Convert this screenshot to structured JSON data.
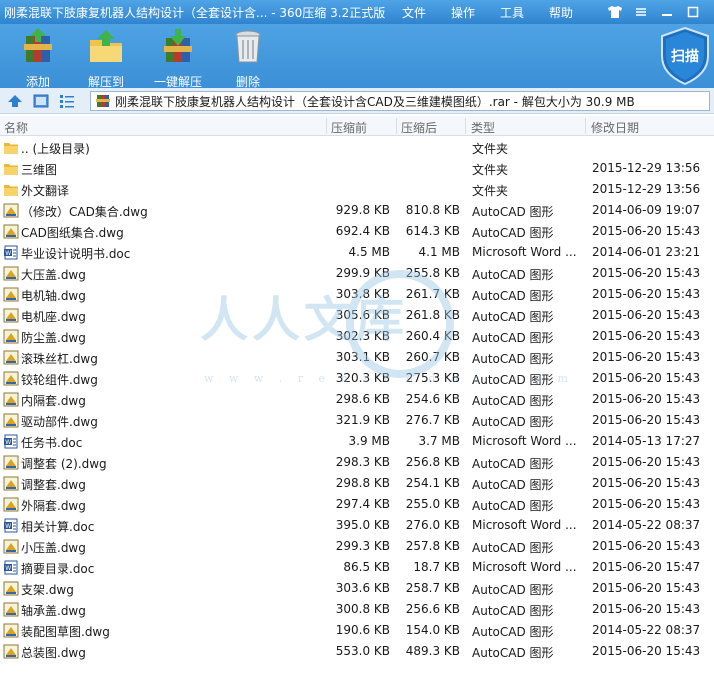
{
  "window": {
    "title": "刚柔混联下肢康复机器人结构设计（全套设计含... - 360压缩 3.2正式版",
    "menus": [
      "文件",
      "操作",
      "工具",
      "帮助"
    ]
  },
  "toolbar": {
    "add_label": "添加",
    "extract_label": "解压到",
    "oneclick_label": "一键解压",
    "delete_label": "删除",
    "scan_label": "扫描"
  },
  "address": {
    "path": "刚柔混联下肢康复机器人结构设计（全套设计含CAD及三维建模图纸）.rar - 解包大小为 30.9 MB"
  },
  "columns": {
    "name": "名称",
    "compressed": "压缩前",
    "original": "压缩后",
    "type": "类型",
    "modified": "修改日期"
  },
  "watermark": {
    "text": "人人文库",
    "url": "w w w . r e n r e n d o c . c o m"
  },
  "files": [
    {
      "icon": "folder-up-icon",
      "name": ".. (上级目录)",
      "comp": "",
      "orig": "",
      "type": "文件夹",
      "date": ""
    },
    {
      "icon": "folder-icon",
      "name": "三维图",
      "comp": "",
      "orig": "",
      "type": "文件夹",
      "date": "2015-12-29 13:56"
    },
    {
      "icon": "folder-icon",
      "name": "外文翻译",
      "comp": "",
      "orig": "",
      "type": "文件夹",
      "date": "2015-12-29 13:56"
    },
    {
      "icon": "dwg-icon",
      "name": "（修改）CAD集合.dwg",
      "comp": "929.8 KB",
      "orig": "810.8 KB",
      "type": "AutoCAD 图形",
      "date": "2014-06-09 19:07"
    },
    {
      "icon": "dwg-icon",
      "name": "CAD图纸集合.dwg",
      "comp": "692.4 KB",
      "orig": "614.3 KB",
      "type": "AutoCAD 图形",
      "date": "2015-06-20 15:43"
    },
    {
      "icon": "doc-icon",
      "name": "毕业设计说明书.doc",
      "comp": "4.5 MB",
      "orig": "4.1 MB",
      "type": "Microsoft Word ...",
      "date": "2014-06-01 23:21"
    },
    {
      "icon": "dwg-icon",
      "name": "大压盖.dwg",
      "comp": "299.9 KB",
      "orig": "255.8 KB",
      "type": "AutoCAD 图形",
      "date": "2015-06-20 15:43"
    },
    {
      "icon": "dwg-icon",
      "name": "电机轴.dwg",
      "comp": "303.8 KB",
      "orig": "261.7 KB",
      "type": "AutoCAD 图形",
      "date": "2015-06-20 15:43"
    },
    {
      "icon": "dwg-icon",
      "name": "电机座.dwg",
      "comp": "305.6 KB",
      "orig": "261.8 KB",
      "type": "AutoCAD 图形",
      "date": "2015-06-20 15:43"
    },
    {
      "icon": "dwg-icon",
      "name": "防尘盖.dwg",
      "comp": "302.3 KB",
      "orig": "260.4 KB",
      "type": "AutoCAD 图形",
      "date": "2015-06-20 15:43"
    },
    {
      "icon": "dwg-icon",
      "name": "滚珠丝杠.dwg",
      "comp": "303.1 KB",
      "orig": "260.7 KB",
      "type": "AutoCAD 图形",
      "date": "2015-06-20 15:43"
    },
    {
      "icon": "dwg-icon",
      "name": "铰轮组件.dwg",
      "comp": "320.3 KB",
      "orig": "275.3 KB",
      "type": "AutoCAD 图形",
      "date": "2015-06-20 15:43"
    },
    {
      "icon": "dwg-icon",
      "name": "内隔套.dwg",
      "comp": "298.6 KB",
      "orig": "254.6 KB",
      "type": "AutoCAD 图形",
      "date": "2015-06-20 15:43"
    },
    {
      "icon": "dwg-icon",
      "name": "驱动部件.dwg",
      "comp": "321.9 KB",
      "orig": "276.7 KB",
      "type": "AutoCAD 图形",
      "date": "2015-06-20 15:43"
    },
    {
      "icon": "doc-icon",
      "name": "任务书.doc",
      "comp": "3.9 MB",
      "orig": "3.7 MB",
      "type": "Microsoft Word ...",
      "date": "2014-05-13 17:27"
    },
    {
      "icon": "dwg-icon",
      "name": "调整套 (2).dwg",
      "comp": "298.3 KB",
      "orig": "256.8 KB",
      "type": "AutoCAD 图形",
      "date": "2015-06-20 15:43"
    },
    {
      "icon": "dwg-icon",
      "name": "调整套.dwg",
      "comp": "298.8 KB",
      "orig": "254.1 KB",
      "type": "AutoCAD 图形",
      "date": "2015-06-20 15:43"
    },
    {
      "icon": "dwg-icon",
      "name": "外隔套.dwg",
      "comp": "297.4 KB",
      "orig": "255.0 KB",
      "type": "AutoCAD 图形",
      "date": "2015-06-20 15:43"
    },
    {
      "icon": "doc-icon",
      "name": "相关计算.doc",
      "comp": "395.0 KB",
      "orig": "276.0 KB",
      "type": "Microsoft Word ...",
      "date": "2014-05-22 08:37"
    },
    {
      "icon": "dwg-icon",
      "name": "小压盖.dwg",
      "comp": "299.3 KB",
      "orig": "257.8 KB",
      "type": "AutoCAD 图形",
      "date": "2015-06-20 15:43"
    },
    {
      "icon": "doc-icon",
      "name": "摘要目录.doc",
      "comp": "86.5 KB",
      "orig": "18.7 KB",
      "type": "Microsoft Word ...",
      "date": "2015-06-20 15:47"
    },
    {
      "icon": "dwg-icon",
      "name": "支架.dwg",
      "comp": "303.6 KB",
      "orig": "258.7 KB",
      "type": "AutoCAD 图形",
      "date": "2015-06-20 15:43"
    },
    {
      "icon": "dwg-icon",
      "name": "轴承盖.dwg",
      "comp": "300.8 KB",
      "orig": "256.6 KB",
      "type": "AutoCAD 图形",
      "date": "2015-06-20 15:43"
    },
    {
      "icon": "dwg-icon",
      "name": "装配图草图.dwg",
      "comp": "190.6 KB",
      "orig": "154.0 KB",
      "type": "AutoCAD 图形",
      "date": "2014-05-22 08:37"
    },
    {
      "icon": "dwg-icon",
      "name": "总装图.dwg",
      "comp": "553.0 KB",
      "orig": "489.3 KB",
      "type": "AutoCAD 图形",
      "date": "2015-06-20 15:43"
    }
  ]
}
